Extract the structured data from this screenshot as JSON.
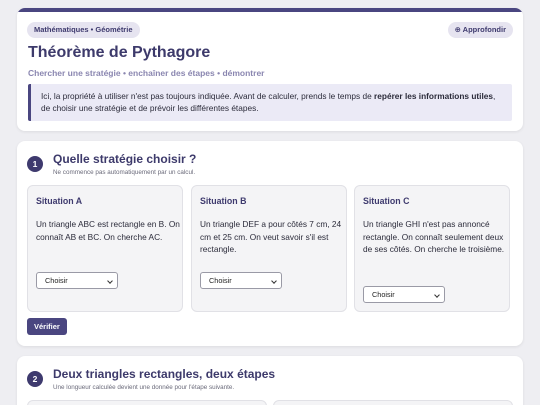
{
  "header": {
    "subject_badge": "Mathématiques • Géométrie",
    "deepen_button": "⊕ Approfondir",
    "title": "Théorème de Pythagore",
    "subtitle": "Chercher une stratégie • enchaîner des étapes • démontrer",
    "intro": {
      "part1": "Ici, la propriété à utiliser n'est pas toujours indiquée. Avant de calculer, prends le temps de ",
      "bold": "repérer les informations utiles",
      "part2": ", de choisir une stratégie et de prévoir les différentes étapes."
    }
  },
  "section1": {
    "number": "1",
    "title": "Quelle stratégie choisir ?",
    "description": "Ne commence pas automatiquement par un calcul.",
    "situations": [
      {
        "title": "Situation A",
        "text": "Un triangle ABC est rectangle en B. On connaît AB et BC. On cherche AC.",
        "select_value": "Choisir"
      },
      {
        "title": "Situation B",
        "text": "Un triangle DEF a pour côtés 7 cm, 24 cm et 25 cm. On veut savoir s'il est rectangle.",
        "select_value": "Choisir"
      },
      {
        "title": "Situation C",
        "text": "Un triangle GHI n'est pas annoncé rectangle. On connaît seulement deux de ses côtés. On cherche le troisième.",
        "select_value": "Choisir"
      }
    ],
    "verify_button": "Vérifier"
  },
  "section2": {
    "number": "2",
    "title": "Deux triangles rectangles, deux étapes",
    "description": "Une longueur calculée devient une donnée pour l'étape suivante."
  },
  "colors": {
    "accent": "#4a4680",
    "title": "#3d3a6b",
    "background": "#eeeef2",
    "intro_bg": "#ebeaf6"
  }
}
